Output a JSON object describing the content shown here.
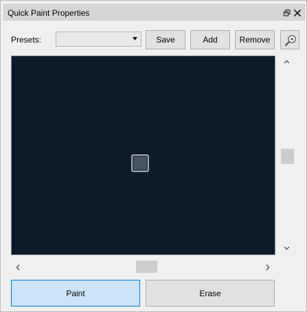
{
  "window": {
    "title": "Quick Paint Properties",
    "icons": [
      "float-icon",
      "close-icon"
    ]
  },
  "toolbar": {
    "presets_label": "Presets:",
    "presets_value": "",
    "save_label": "Save",
    "add_label": "Add",
    "remove_label": "Remove",
    "zoom_icon": "zoom-icon"
  },
  "preview": {
    "background": "#0c1b2a",
    "brush_fill": "#4a5561",
    "brush_border": "#9aa6b2"
  },
  "scrollbars": {
    "vertical": {
      "up_icon": "chevron-up-icon",
      "down_icon": "chevron-down-icon"
    },
    "horizontal": {
      "left_icon": "chevron-left-icon",
      "right_icon": "chevron-right-icon"
    }
  },
  "actions": {
    "paint_label": "Paint",
    "erase_label": "Erase",
    "active": "Paint"
  },
  "colors": {
    "panel_bg": "#f0f0f0",
    "title_bar": "#d6d6d6",
    "button_bg": "#e1e1e1",
    "active_button_bg": "#cce4f7",
    "active_button_border": "#0078d7"
  }
}
